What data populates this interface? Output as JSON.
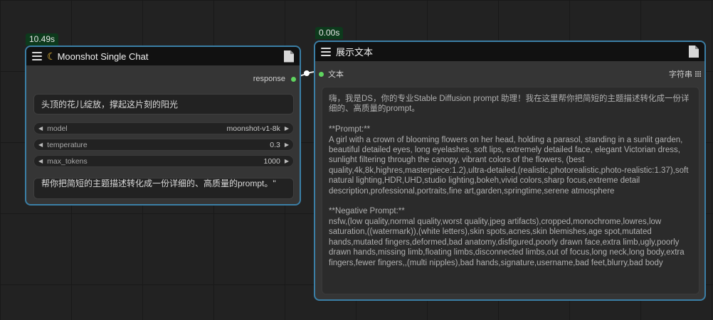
{
  "node1": {
    "timer": "10.49s",
    "title": "Moonshot Single Chat",
    "title_icon": "moon-icon",
    "output_label": "response",
    "prompt_text": "头顶的花儿绽放，撑起这片刻的阳光",
    "widgets": [
      {
        "label": "model",
        "value": "moonshot-v1-8k"
      },
      {
        "label": "temperature",
        "value": "0.3"
      },
      {
        "label": "max_tokens",
        "value": "1000"
      }
    ],
    "system_text": "帮你把简短的主题描述转化成一份详细的、高质量的prompt。\""
  },
  "node2": {
    "timer": "0.00s",
    "title": "展示文本",
    "input_label": "文本",
    "output_label": "字符串",
    "output_text": "嗨，我是DS，你的专业Stable Diffusion prompt 助理！我在这里帮你把简短的主题描述转化成一份详细的、高质量的prompt。\n\n**Prompt:**\nA girl with a crown of blooming flowers on her head, holding a parasol, standing in a sunlit garden, beautiful detailed eyes, long eyelashes, soft lips, extremely detailed face, elegant Victorian dress, sunlight filtering through the canopy, vibrant colors of the flowers, (best quality,4k,8k,highres,masterpiece:1.2),ultra-detailed,(realistic,photorealistic,photo-realistic:1.37),soft natural lighting,HDR,UHD,studio lighting,bokeh,vivid colors,sharp focus,extreme detail description,professional,portraits,fine art,garden,springtime,serene atmosphere\n\n**Negative Prompt:**\nnsfw,(low quality,normal quality,worst quality,jpeg artifacts),cropped,monochrome,lowres,low saturation,((watermark)),(white letters),skin spots,acnes,skin blemishes,age spot,mutated hands,mutated fingers,deformed,bad anatomy,disfigured,poorly drawn face,extra limb,ugly,poorly drawn hands,missing limb,floating limbs,disconnected limbs,out of focus,long neck,long body,extra fingers,fewer fingers,,(multi nipples),bad hands,signature,username,bad feet,blurry,bad body"
  },
  "colors": {
    "canvas": "#222222",
    "node_border": "#3b7fa6",
    "timer_bg": "#0d3a1c",
    "slot_green": "#5fd45f"
  }
}
